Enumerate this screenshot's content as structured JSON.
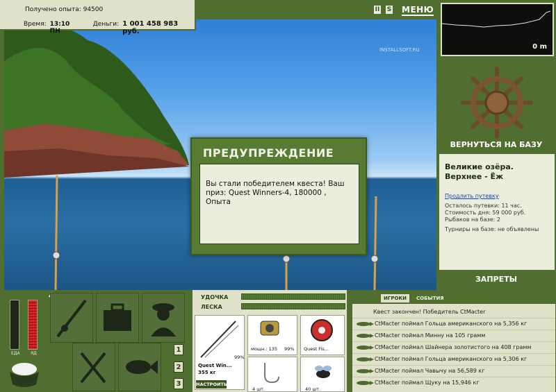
{
  "player": {
    "xp_label": "Получено опыта: 94500",
    "time_label": "Время:",
    "time_value": "13:10 ПН",
    "money_label": "Деньги:",
    "money_value": "1 001 458 983 руб."
  },
  "top_controls": {
    "pause_label": "II",
    "sound_label": "S",
    "menu_label": "МЕНЮ",
    "watermark": "INSTALLSOFT.RU"
  },
  "dialog": {
    "title": "ПРЕДУПРЕЖДЕНИЕ",
    "message": "Вы стали победителем квеста! Ваш приз: Quest Winners-4, 180000 , Опыта"
  },
  "minimap": {
    "depth": "0 m"
  },
  "right_panel": {
    "return_button": "ВЕРНУТЬСЯ НА БАЗУ",
    "location_title": "Великие озёра. Верхнее - Ёж",
    "extend_link": "Продлить путевку",
    "remaining": "Осталось путевки: 11 час.",
    "cost": "Стоимость дня: 59 000 руб.",
    "fishers": "Рыбаков на базе: 2",
    "tournaments": "Турниры на базе: не объявлены",
    "bans_button": "ЗАПРЕТЫ"
  },
  "meters": {
    "food_label": "ЕДА",
    "poison_label": "ЯД"
  },
  "slots": [
    "1",
    "2",
    "3"
  ],
  "tackle": {
    "rod_label": "УДОЧКА",
    "line_label": "ЛЕСКА",
    "rod_name": "Quest Win...",
    "rod_weight": "355 кг",
    "rod_percent": "99%",
    "reel_power": "мощн.: 135",
    "reel_percent": "99%",
    "line_name": "Quest Fis...",
    "hook_count": "4 шт.",
    "bait_count": "40 шт.",
    "setup_button": "НАСТРОИТЬ"
  },
  "events": {
    "tab_players": "ИГРОКИ",
    "tab_events": "СОБЫТИЯ",
    "quest_line": "Квест закончен! Победитель CtMacter",
    "rows": [
      "CtMacter поймал Гольца американского на 5,356 кг",
      "CtMacter поймал Минну на 105 грамм",
      "CtMacter поймал Шайнера золотистого на 408 грамм",
      "CtMacter поймал Гольца американского на 5,306 кг",
      "CtMacter поймал Чавычу на 56,589 кг",
      "CtMacter поймал Щуку на 15,946 кг"
    ]
  },
  "colors": {
    "panel_green": "#4f6e2f",
    "panel_light": "#dfe2c9",
    "dialog_green": "#587b34"
  }
}
